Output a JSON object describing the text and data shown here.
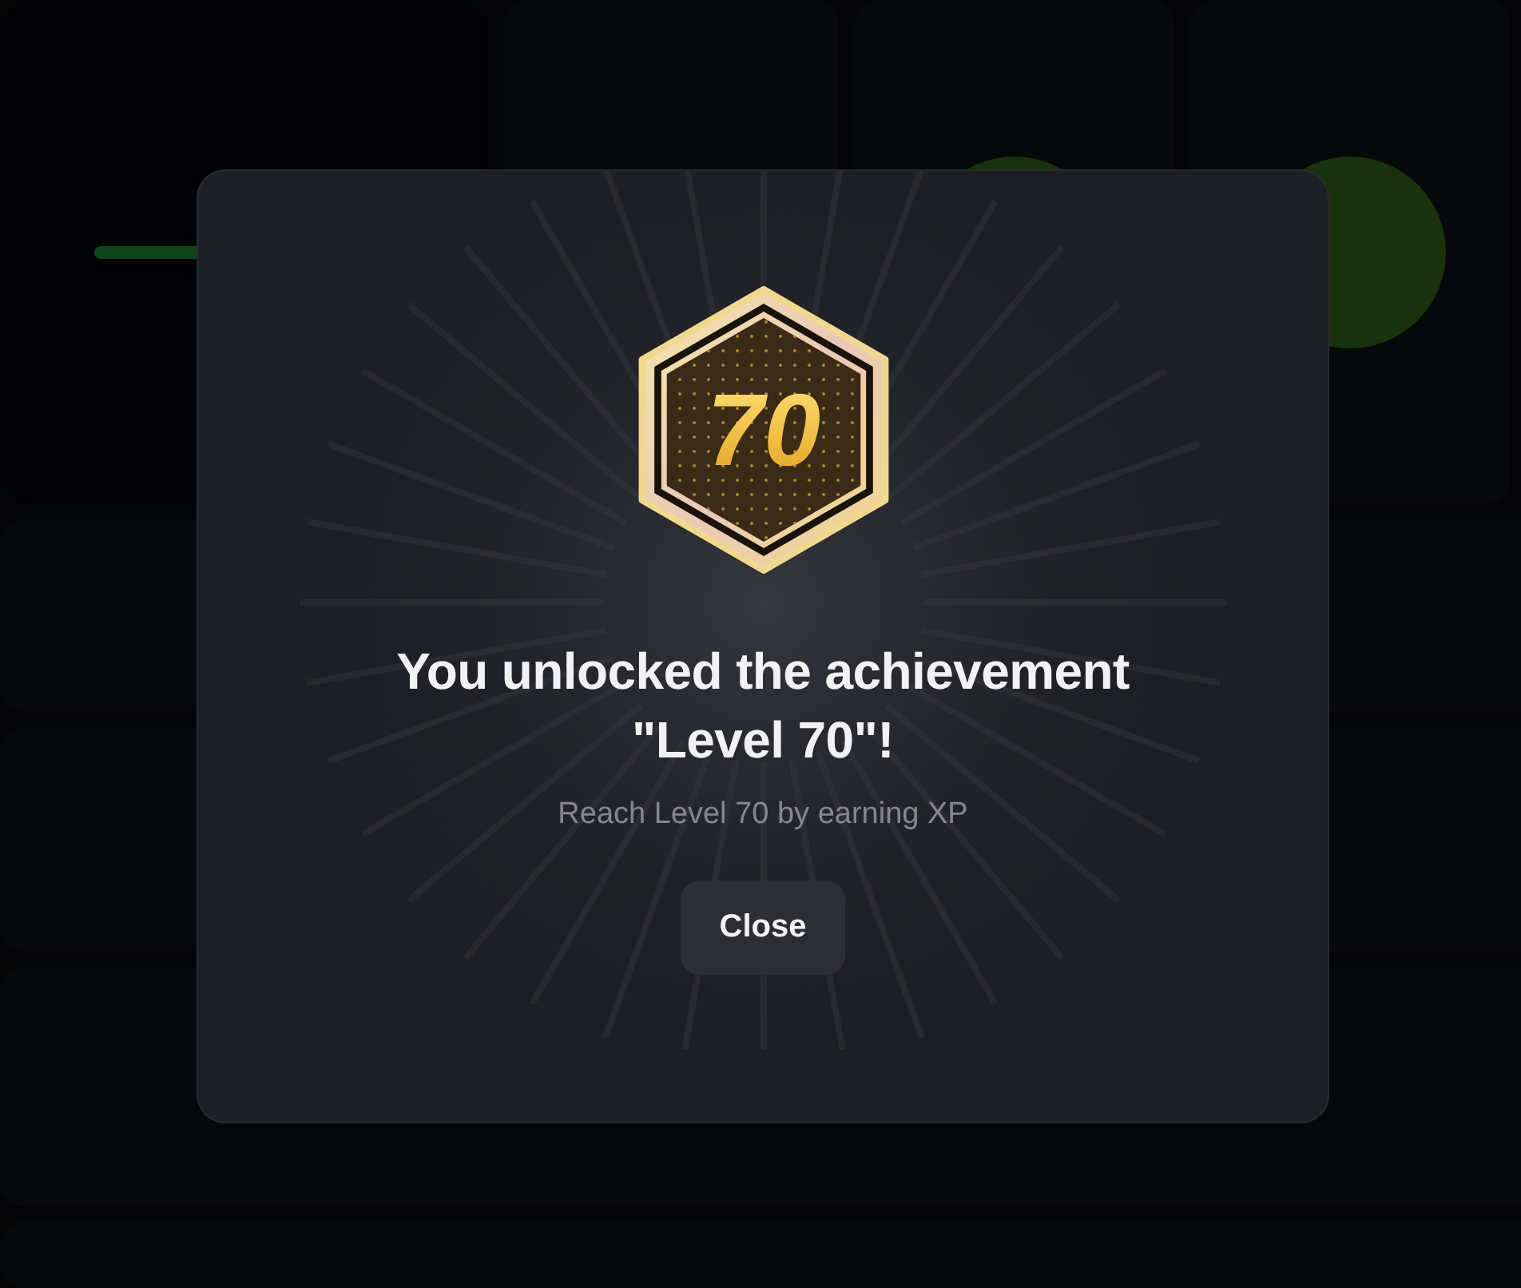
{
  "dialog": {
    "badge": {
      "label": "70"
    },
    "title": "You unlocked the achievement \"Level 70\"!",
    "description": "Reach Level 70 by earning XP",
    "buttons": [
      {
        "label": "Close"
      }
    ]
  }
}
